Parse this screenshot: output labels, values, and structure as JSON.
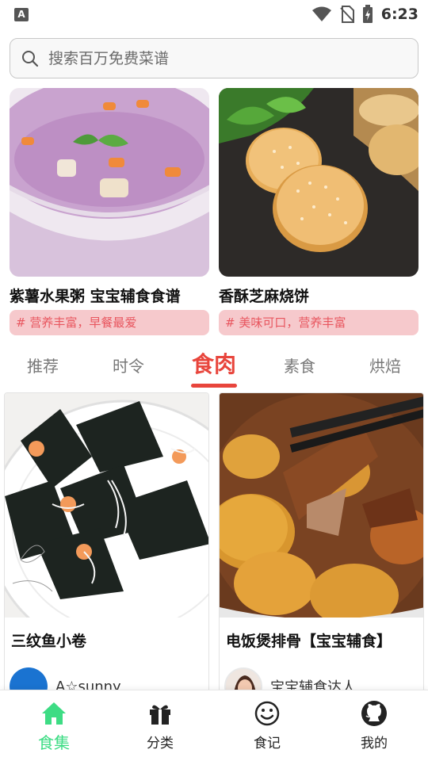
{
  "status_bar": {
    "notification_icon": "A",
    "time": "6:23",
    "icons": [
      "wifi-icon",
      "no-sim-icon",
      "battery-charging-icon"
    ]
  },
  "search": {
    "placeholder": "搜索百万免费菜谱",
    "icon": "search-icon"
  },
  "featured": [
    {
      "title": "紫薯水果粥  宝宝辅食食谱",
      "tag": "# 营养丰富，早餐最爱"
    },
    {
      "title": "香酥芝麻烧饼",
      "tag": "# 美味可口，营养丰富"
    }
  ],
  "tabs": [
    {
      "label": "推荐"
    },
    {
      "label": "时令"
    },
    {
      "label": "食肉",
      "active": true
    },
    {
      "label": "素食"
    },
    {
      "label": "烘焙"
    }
  ],
  "recipes": [
    {
      "title": "三纹鱼小卷",
      "author": "A☆sunny"
    },
    {
      "title": "电饭煲排骨【宝宝辅食】",
      "author": "宝宝辅食达人"
    }
  ],
  "bottom_nav": [
    {
      "label": "食集",
      "icon": "home-icon",
      "active": true
    },
    {
      "label": "分类",
      "icon": "gift-icon"
    },
    {
      "label": "食记",
      "icon": "smiley-icon"
    },
    {
      "label": "我的",
      "icon": "github-icon"
    }
  ],
  "colors": {
    "accent_red": "#e8453c",
    "active_green": "#3ddc84",
    "tag_bg": "#f6c9cc",
    "tag_text": "#e8565f"
  }
}
